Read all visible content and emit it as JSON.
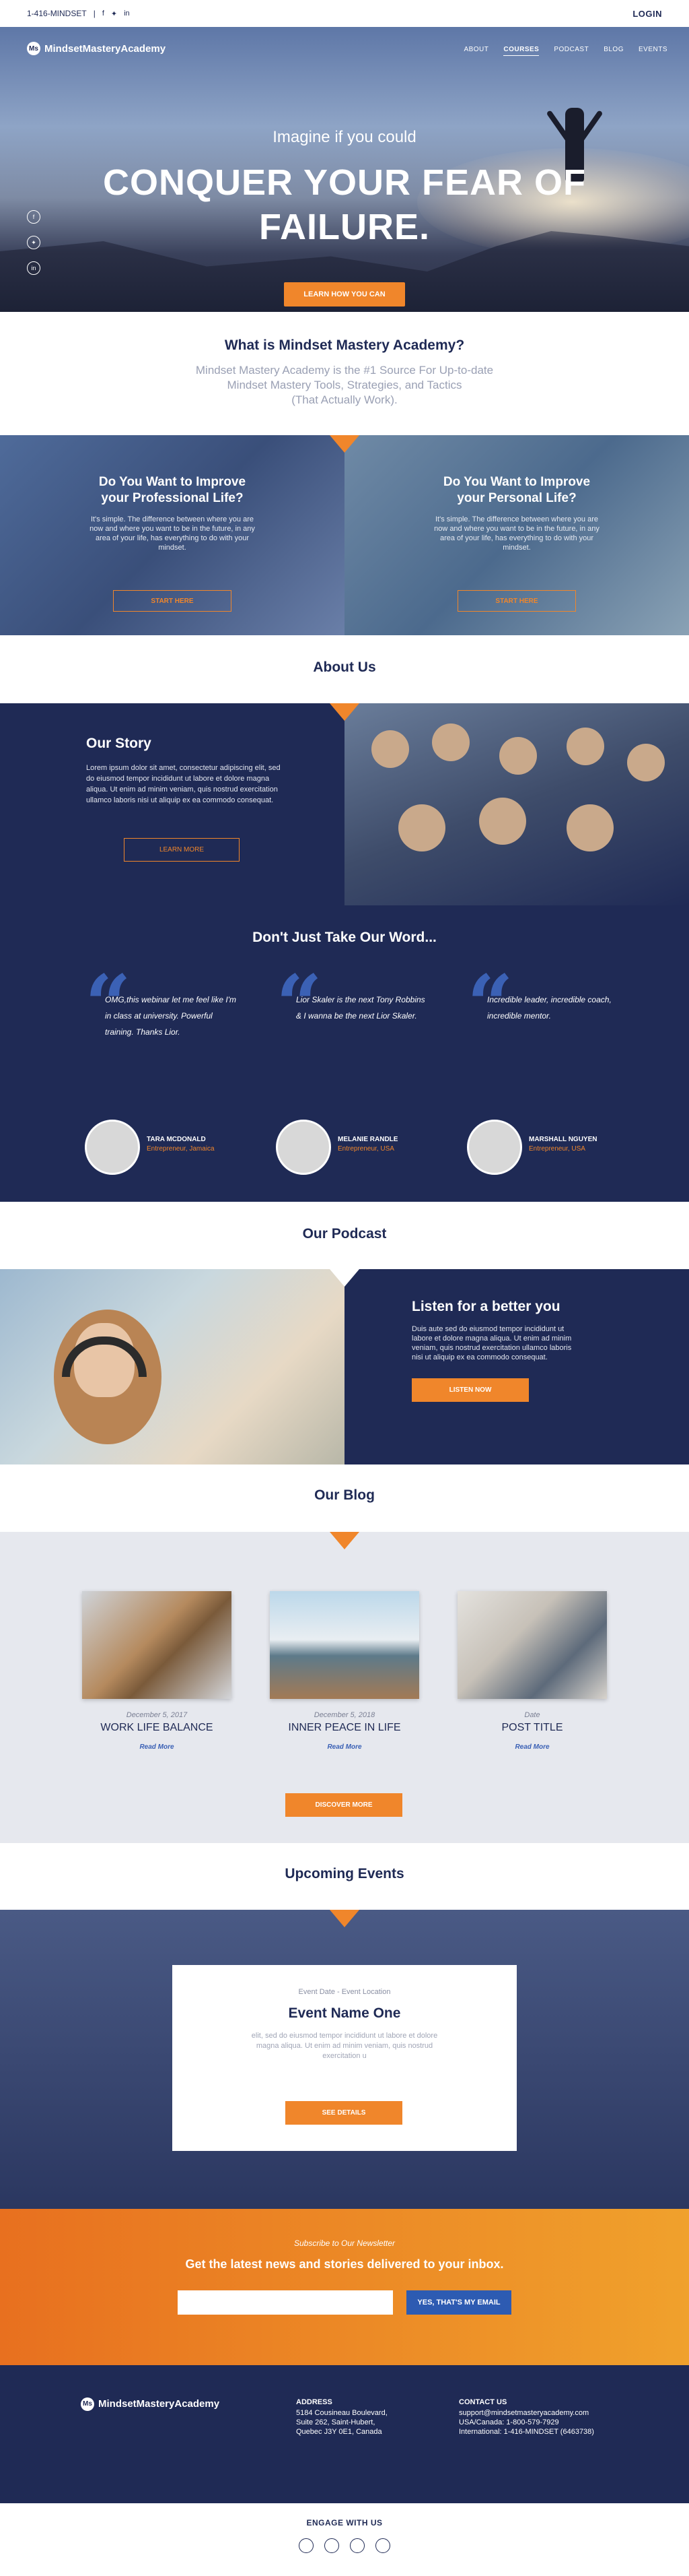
{
  "topbar": {
    "phone": "1-416-MINDSET",
    "sep": "|",
    "login": "LOGIN",
    "social_icons": [
      "facebook-icon",
      "twitter-icon",
      "linkedin-icon"
    ]
  },
  "header": {
    "logo_mark": "Ms",
    "logo_text": "MindsetMasteryAcademy",
    "nav": [
      "ABOUT",
      "COURSES",
      "PODCAST",
      "BLOG",
      "EVENTS"
    ],
    "active_nav": "COURSES"
  },
  "hero": {
    "subtitle": "Imagine if you could",
    "title": "CONQUER YOUR FEAR OF FAILURE.",
    "cta": "LEARN HOW YOU CAN"
  },
  "whatis": {
    "title": "What is Mindset Mastery Academy?",
    "line1": "Mindset Mastery Academy is the #1 Source For Up-to-date",
    "line2": "Mindset Mastery Tools, Strategies, and Tactics",
    "line3": "(That Actually Work)."
  },
  "improve": [
    {
      "title": "Do You Want to Improve your Professional Life?",
      "text": "It's simple. The difference between where you are now and where you want to be in the future, in any area of your life, has everything to do with your mindset.",
      "button": "START HERE"
    },
    {
      "title": "Do You Want to Improve your Personal Life?",
      "text": "It's simple. The difference between where you are now and where you want to be in the future, in any area of your life, has everything to do with your mindset.",
      "button": "START HERE"
    }
  ],
  "about": {
    "heading": "About Us",
    "title": "Our Story",
    "text": "Lorem ipsum dolor sit amet, consectetur adipiscing elit, sed do eiusmod tempor incididunt ut labore et dolore magna aliqua. Ut enim ad minim veniam, quis nostrud exercitation ullamco laboris nisi ut aliquip ex ea commodo consequat.",
    "button": "LEARN MORE"
  },
  "testimonials": {
    "heading": "Don't Just Take Our Word...",
    "items": [
      {
        "quote": "OMG,this webinar let me feel like I'm in class at university. Powerful training. Thanks Lior.",
        "name": "TARA MCDONALD",
        "role": "Entrepreneur, Jamaica"
      },
      {
        "quote": "Lior Skaler is the next Tony Robbins & I wanna be the next Lior Skaler.",
        "name": "MELANIE RANDLE",
        "role": "Entrepreneur, USA"
      },
      {
        "quote": "Incredible leader, incredible coach, incredible mentor.",
        "name": "MARSHALL NGUYEN",
        "role": "Entrepreneur, USA"
      }
    ]
  },
  "podcast": {
    "heading": "Our Podcast",
    "title": "Listen for a better you",
    "text": "Duis aute  sed do eiusmod tempor incididunt ut labore et dolore magna aliqua. Ut enim ad minim veniam, quis nostrud exercitation ullamco laboris nisi ut aliquip ex ea commodo consequat.",
    "button": "LISTEN NOW"
  },
  "blog": {
    "heading": "Our Blog",
    "posts": [
      {
        "date": "December 5, 2017",
        "title": "WORK LIFE BALANCE",
        "link": "Read More"
      },
      {
        "date": "December 5, 2018",
        "title": "INNER PEACE IN LIFE",
        "link": "Read More"
      },
      {
        "date": "Date",
        "title": "POST TITLE",
        "link": "Read More"
      }
    ],
    "button": "DISCOVER MORE"
  },
  "events": {
    "heading": "Upcoming Events",
    "meta": "Event Date - Event Location",
    "name": "Event Name One",
    "text": "elit, sed do eiusmod tempor incididunt ut labore et dolore magna aliqua. Ut enim ad minim veniam, quis nostrud exercitation u",
    "button": "SEE DETAILS"
  },
  "newsletter": {
    "kicker": "Subscribe to Our Newsletter",
    "title": "Get the latest news and stories delivered to your inbox.",
    "input_placeholder": "",
    "button": "YES, THAT'S MY EMAIL"
  },
  "footer": {
    "logo_mark": "Ms",
    "logo_text": "MindsetMasteryAcademy",
    "address_title": "ADDRESS",
    "address": [
      "5184 Cousineau Boulevard,",
      "Suite 262, Saint-Hubert,",
      "Quebec J3Y 0E1, Canada"
    ],
    "contact_title": "CONTACT US",
    "contact": [
      "support@mindsetmasteryacademy.com",
      "USA/Canada: 1-800-579-7929",
      "International: 1-416-MINDSET (6463738)"
    ]
  },
  "engage": {
    "title": "ENGAGE WITH US",
    "icons": [
      "facebook-icon",
      "twitter-icon",
      "linkedin-icon",
      "instagram-icon"
    ]
  },
  "colors": {
    "navy": "#1f2a55",
    "orange": "#f0862b",
    "blue": "#3b61b5"
  }
}
